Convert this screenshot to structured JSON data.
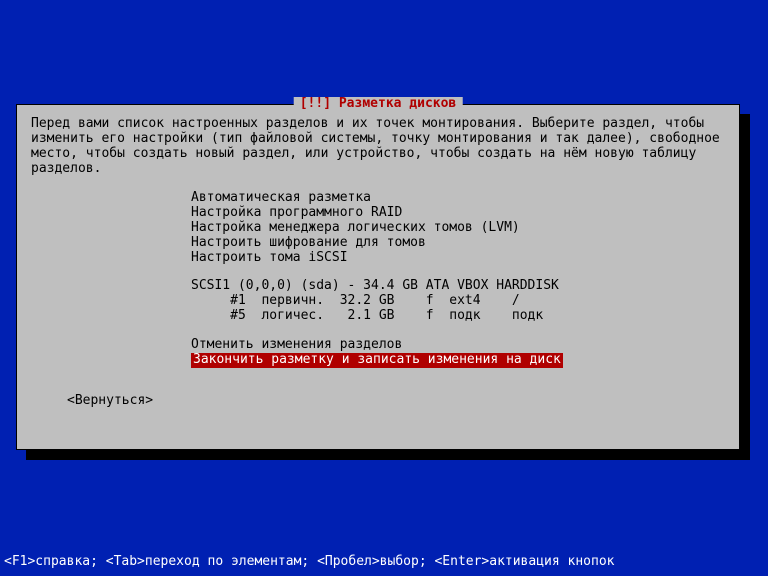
{
  "dialog": {
    "title": "[!!] Разметка дисков",
    "intro": "Перед вами список настроенных разделов и их точек монтирования. Выберите раздел, чтобы изменить его настройки (тип файловой системы, точку монтирования и так далее), свободное место, чтобы создать новый раздел, или устройство, чтобы создать на нём новую таблицу разделов.",
    "menu": {
      "auto": "Автоматическая разметка",
      "raid": "Настройка программного RAID",
      "lvm": "Настройка менеджера логических томов (LVM)",
      "crypt": "Настроить шифрование для томов",
      "iscsi": "Настроить тома iSCSI",
      "disk": "SCSI1 (0,0,0) (sda) - 34.4 GB ATA VBOX HARDDISK",
      "part1": "     #1  первичн.  32.2 GB    f  ext4    /",
      "part5": "     #5  логичес.   2.1 GB    f  подк    подк",
      "undo": "Отменить изменения разделов",
      "finish": "Закончить разметку и записать изменения на диск"
    },
    "back": "<Вернуться>"
  },
  "footer": {
    "text": "<F1>справка; <Tab>переход по элементам; <Пробел>выбор; <Enter>активация кнопок"
  }
}
